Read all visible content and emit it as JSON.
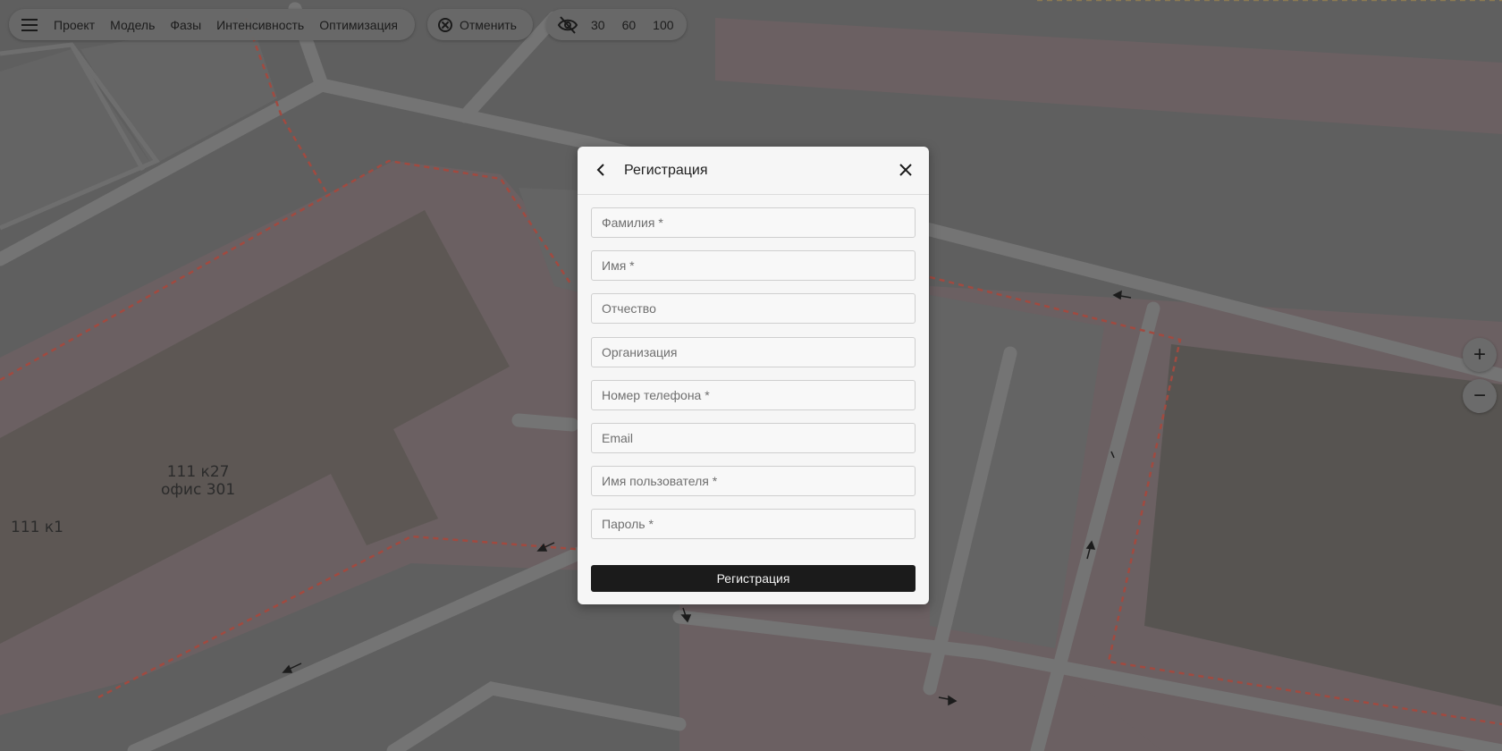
{
  "toolbar": {
    "nav": [
      {
        "label": "Проект"
      },
      {
        "label": "Модель"
      },
      {
        "label": "Фазы"
      },
      {
        "label": "Интенсивность"
      },
      {
        "label": "Оптимизация"
      }
    ],
    "cancel_label": "Отменить",
    "speeds": [
      "30",
      "60",
      "100"
    ]
  },
  "map": {
    "labels": {
      "building_a_line1": "111 к27",
      "building_a_line2": "офис 301",
      "building_b": "111 к1"
    },
    "overlay_color": "#5e5e5e"
  },
  "zoom": {
    "in_symbol": "+",
    "out_symbol": "−"
  },
  "modal": {
    "title": "Регистрация",
    "fields": [
      {
        "placeholder": "Фамилия *"
      },
      {
        "placeholder": "Имя *"
      },
      {
        "placeholder": "Отчество"
      },
      {
        "placeholder": "Организация"
      },
      {
        "placeholder": "Номер телефона *"
      },
      {
        "placeholder": "Email"
      },
      {
        "placeholder": "Имя пользователя *"
      },
      {
        "placeholder": "Пароль *"
      }
    ],
    "submit_label": "Регистрация",
    "submit_color": "#1b1b1b"
  }
}
